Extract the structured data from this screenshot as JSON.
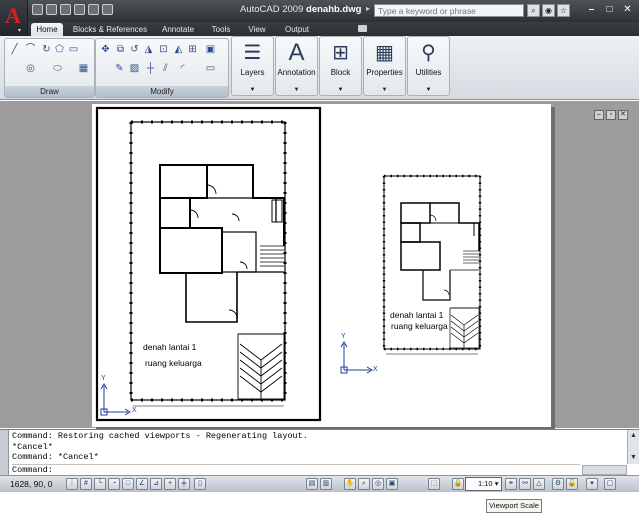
{
  "app": {
    "title_prefix": "AutoCAD 2009",
    "file_name": "denahb.dwg",
    "logo_letter": "A",
    "search_placeholder": "Type a keyword or phrase"
  },
  "ribbon_tabs": [
    "Home",
    "Blocks & References",
    "Annotate",
    "Tools",
    "View",
    "Output"
  ],
  "ribbon_panels": {
    "draw_title": "Draw",
    "modify_title": "Modify",
    "big_buttons": [
      {
        "label": "Layers",
        "icon": "layers-icon",
        "glyph": "☰"
      },
      {
        "label": "Annotation",
        "icon": "annotation-icon",
        "glyph": "A"
      },
      {
        "label": "Block",
        "icon": "block-icon",
        "glyph": "⊞"
      },
      {
        "label": "Properties",
        "icon": "properties-icon",
        "glyph": "▦"
      },
      {
        "label": "Utilities",
        "icon": "utilities-icon",
        "glyph": "⚲"
      }
    ]
  },
  "drawing": {
    "left_view_label_1": "denah lantai 1",
    "left_view_label_2": "ruang keluarga",
    "right_view_label_1": "denah lantai 1",
    "right_view_label_2": "ruang keluarga",
    "axis_x": "X",
    "axis_y": "Y"
  },
  "command_line": {
    "lines": [
      "Command: Restoring cached viewports - Regenerating layout.",
      "*Cancel*",
      "Command: *Cancel*"
    ],
    "prompt": "Command:"
  },
  "status_bar": {
    "coordinates": "1628, 90, 0",
    "viewport_scale": "1:10"
  },
  "tooltip": "Viewport Scale",
  "colors": {
    "title_bar": "#3f4246",
    "logo_red": "#d8211c",
    "canvas_gray": "#9c9c9c",
    "ucs_blue": "#1f3c9a"
  }
}
